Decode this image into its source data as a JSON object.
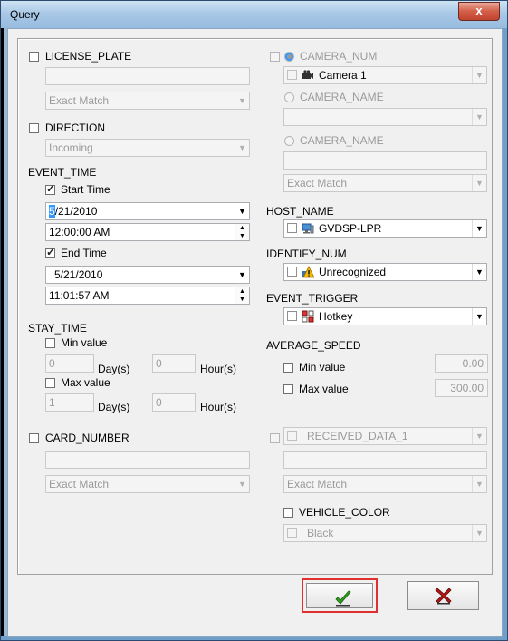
{
  "window": {
    "title": "Query",
    "close_glyph": "x"
  },
  "left": {
    "license_plate": {
      "label": "LICENSE_PLATE",
      "value": "",
      "match": "Exact Match"
    },
    "direction": {
      "label": "DIRECTION",
      "value": "Incoming"
    },
    "event_time": {
      "label": "EVENT_TIME",
      "start_label": "Start Time",
      "start_date_prefix": "5",
      "start_date_rest": "/21/2010",
      "start_time": "12:00:00 AM",
      "end_label": "End Time",
      "end_date": "5/21/2010",
      "end_time": "11:01:57 AM"
    },
    "stay_time": {
      "label": "STAY_TIME",
      "min_label": "Min value",
      "min_days": "0",
      "min_hours": "0",
      "max_label": "Max value",
      "max_days": "1",
      "max_hours": "0",
      "days_unit": "Day(s)",
      "hours_unit": "Hour(s)"
    },
    "card_number": {
      "label": "CARD_NUMBER",
      "value": "",
      "match": "Exact Match"
    }
  },
  "right": {
    "camera_num": {
      "label": "CAMERA_NUM",
      "value": "Camera 1"
    },
    "camera_name_1": {
      "label": "CAMERA_NAME",
      "value": ""
    },
    "camera_name_2": {
      "label": "CAMERA_NAME",
      "value": "",
      "match": "Exact Match"
    },
    "host_name": {
      "label": "HOST_NAME",
      "value": "GVDSP-LPR"
    },
    "identify_num": {
      "label": "IDENTIFY_NUM",
      "value": "Unrecognized"
    },
    "event_trigger": {
      "label": "EVENT_TRIGGER",
      "value": "Hotkey"
    },
    "average_speed": {
      "label": "AVERAGE_SPEED",
      "min_label": "Min value",
      "min_value": "0.00",
      "max_label": "Max value",
      "max_value": "300.00"
    },
    "received_data": {
      "label": "RECEIVED_DATA_1",
      "value": "",
      "match": "Exact Match"
    },
    "vehicle_color": {
      "label": "VEHICLE_COLOR",
      "value": "Black"
    }
  },
  "buttons": {
    "ok_icon": "check-icon",
    "cancel_icon": "x-icon"
  },
  "colors": {
    "highlight_border": "#e03030",
    "check_green": "#2e9e1e",
    "cancel_red": "#b01818"
  }
}
